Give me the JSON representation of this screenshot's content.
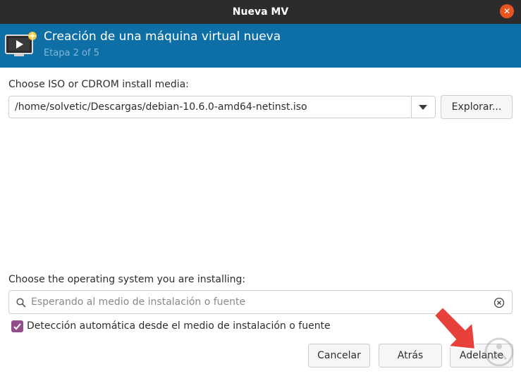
{
  "window": {
    "title": "Nueva MV",
    "close_glyph": "✕"
  },
  "header": {
    "title": "Creación de una máquina virtual nueva",
    "step": "Etapa 2 of 5",
    "icon": "new-vm-monitor-icon"
  },
  "install_media": {
    "label": "Choose ISO or CDROM install media:",
    "value": "/home/solvetic/Descargas/debian-10.6.0-amd64-netinst.iso",
    "browse_label": "Explorar..."
  },
  "os_select": {
    "label": "Choose the operating system you are installing:",
    "placeholder": "Esperando al medio de instalación o fuente"
  },
  "autodetect": {
    "label": "Detección automática desde el medio de instalación o fuente",
    "checked": true
  },
  "footer": {
    "cancel_label": "Cancelar",
    "back_label": "Atrás",
    "forward_label": "Adelante"
  },
  "colors": {
    "titlebar": "#2c2c2c",
    "header": "#0e6fa7",
    "close_button": "#e95420",
    "checkbox": "#924d8b",
    "pointer_arrow": "#e8403a"
  }
}
